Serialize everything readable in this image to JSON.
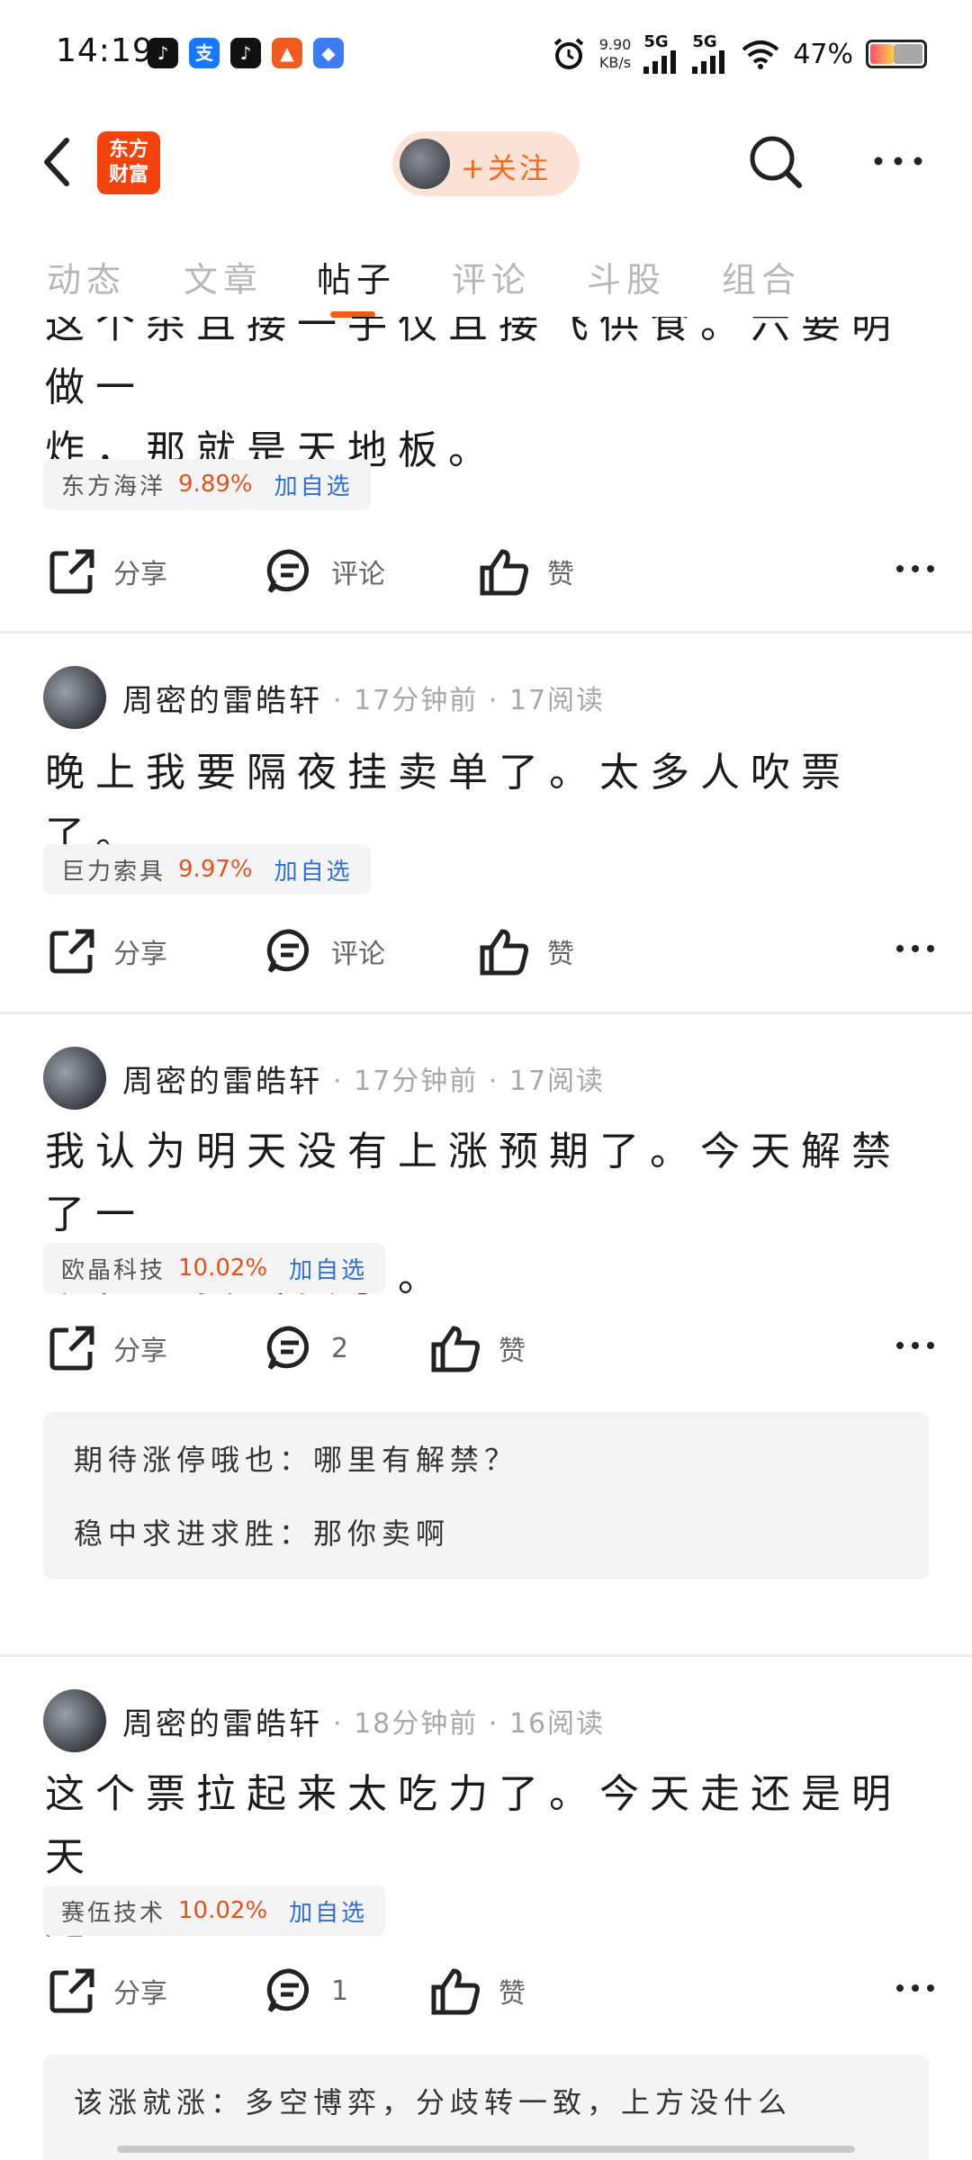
{
  "status_bar": {
    "time": "14:19",
    "apps": [
      {
        "name": "douyin-icon",
        "color": "#111111",
        "glyph": "♪"
      },
      {
        "name": "alipay-icon",
        "color": "#1677ff",
        "glyph": "支"
      },
      {
        "name": "douyin-icon",
        "color": "#111111",
        "glyph": "♪"
      },
      {
        "name": "flag-app-icon",
        "color": "#f25b1f",
        "glyph": "▲"
      },
      {
        "name": "blue-app-icon",
        "color": "#3d7bf2",
        "glyph": "◆"
      }
    ],
    "net_speed_value": "9.90",
    "net_speed_unit": "KB/s",
    "signal1": "5G",
    "signal2": "5G",
    "battery": "47%",
    "battery_level": 0.47
  },
  "header": {
    "logo_line1": "东方",
    "logo_line2": "财富",
    "follow_label": "+关注"
  },
  "tabs": [
    "动态",
    "文章",
    "帖子",
    "评论",
    "斗股",
    "组合"
  ],
  "active_tab": 2,
  "posts": [
    {
      "text_lines": [
        "这个杀且接一手仅且接飞供食。六要明做一",
        "炸，那就是天地板。"
      ],
      "stock": {
        "name": "东方海洋",
        "pct": "9.89%",
        "add": "加自选"
      },
      "actions": {
        "share": "分享",
        "comment": "评论",
        "like": "赞"
      }
    },
    {
      "author": "周密的雷皓轩",
      "meta": "· 17分钟前 · 17阅读",
      "text_lines": [
        "晚上我要隔夜挂卖单了。太多人吹票了。"
      ],
      "stock": {
        "name": "巨力索具",
        "pct": "9.97%",
        "add": "加自选"
      },
      "actions": {
        "share": "分享",
        "comment": "评论",
        "like": "赞"
      }
    },
    {
      "author": "周密的雷皓轩",
      "meta": "· 17分钟前 · 17阅读",
      "text_lines": [
        "我认为明天没有上涨预期了。今天解禁了一",
        "个亿。要出货了。"
      ],
      "stock": {
        "name": "欧晶科技",
        "pct": "10.02%",
        "add": "加自选"
      },
      "actions": {
        "share": "分享",
        "comment": "2",
        "like": "赞"
      },
      "comments": [
        {
          "author": "期待涨停哦也：",
          "text": "哪里有解禁？"
        },
        {
          "author": "稳中求进求胜：",
          "text": "那你卖啊"
        }
      ]
    },
    {
      "author": "周密的雷皓轩",
      "meta": "· 18分钟前 · 16阅读",
      "text_lines": [
        "这个票拉起来太吃力了。今天走还是明天",
        "走。"
      ],
      "stock": {
        "name": "赛伍技术",
        "pct": "10.02%",
        "add": "加自选"
      },
      "actions": {
        "share": "分享",
        "comment": "1",
        "like": "赞"
      },
      "comments": [
        {
          "author": "该涨就涨：",
          "text": "多空博弈，分歧转一致，上方没什么"
        }
      ]
    }
  ]
}
